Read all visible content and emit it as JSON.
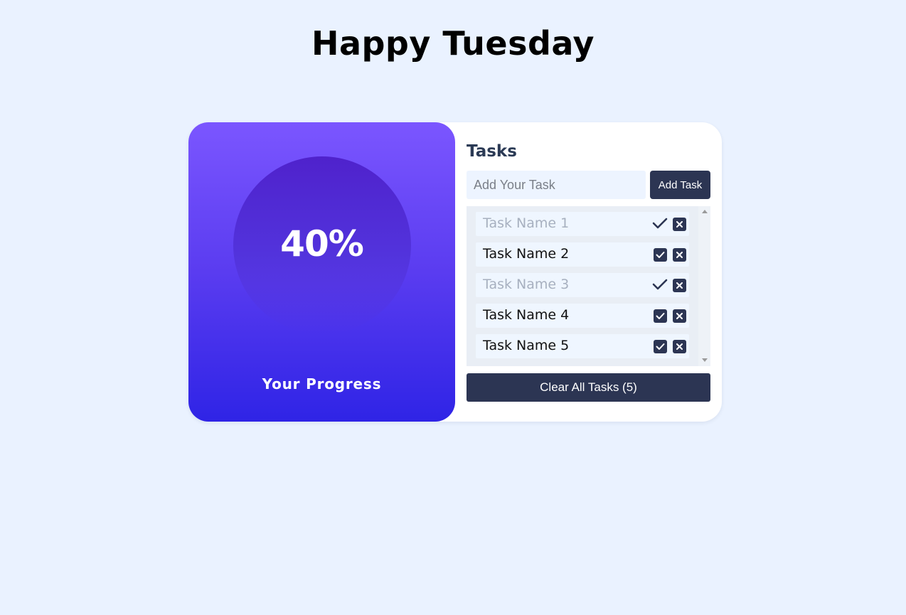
{
  "header": {
    "greeting": "Happy Tuesday"
  },
  "progress": {
    "percent_label": "40%",
    "percent_value": 40,
    "label": "Your Progress"
  },
  "tasks": {
    "title": "Tasks",
    "input": {
      "placeholder": "Add Your Task",
      "value": ""
    },
    "add_button_label": "Add Task",
    "items": [
      {
        "name": "Task Name 1",
        "done": true
      },
      {
        "name": "Task Name 2",
        "done": false
      },
      {
        "name": "Task Name 3",
        "done": true
      },
      {
        "name": "Task Name 4",
        "done": false
      },
      {
        "name": "Task Name 5",
        "done": false
      }
    ],
    "clear_button_label": "Clear All Tasks (5)"
  },
  "colors": {
    "background": "#eaf2ff",
    "accent_dark": "#2c3553",
    "gradient_top": "#7b56ff",
    "gradient_bottom": "#2f24e6",
    "done_text": "#a7b0bf"
  },
  "icons": {
    "complete": "check-icon",
    "delete": "close-icon"
  }
}
